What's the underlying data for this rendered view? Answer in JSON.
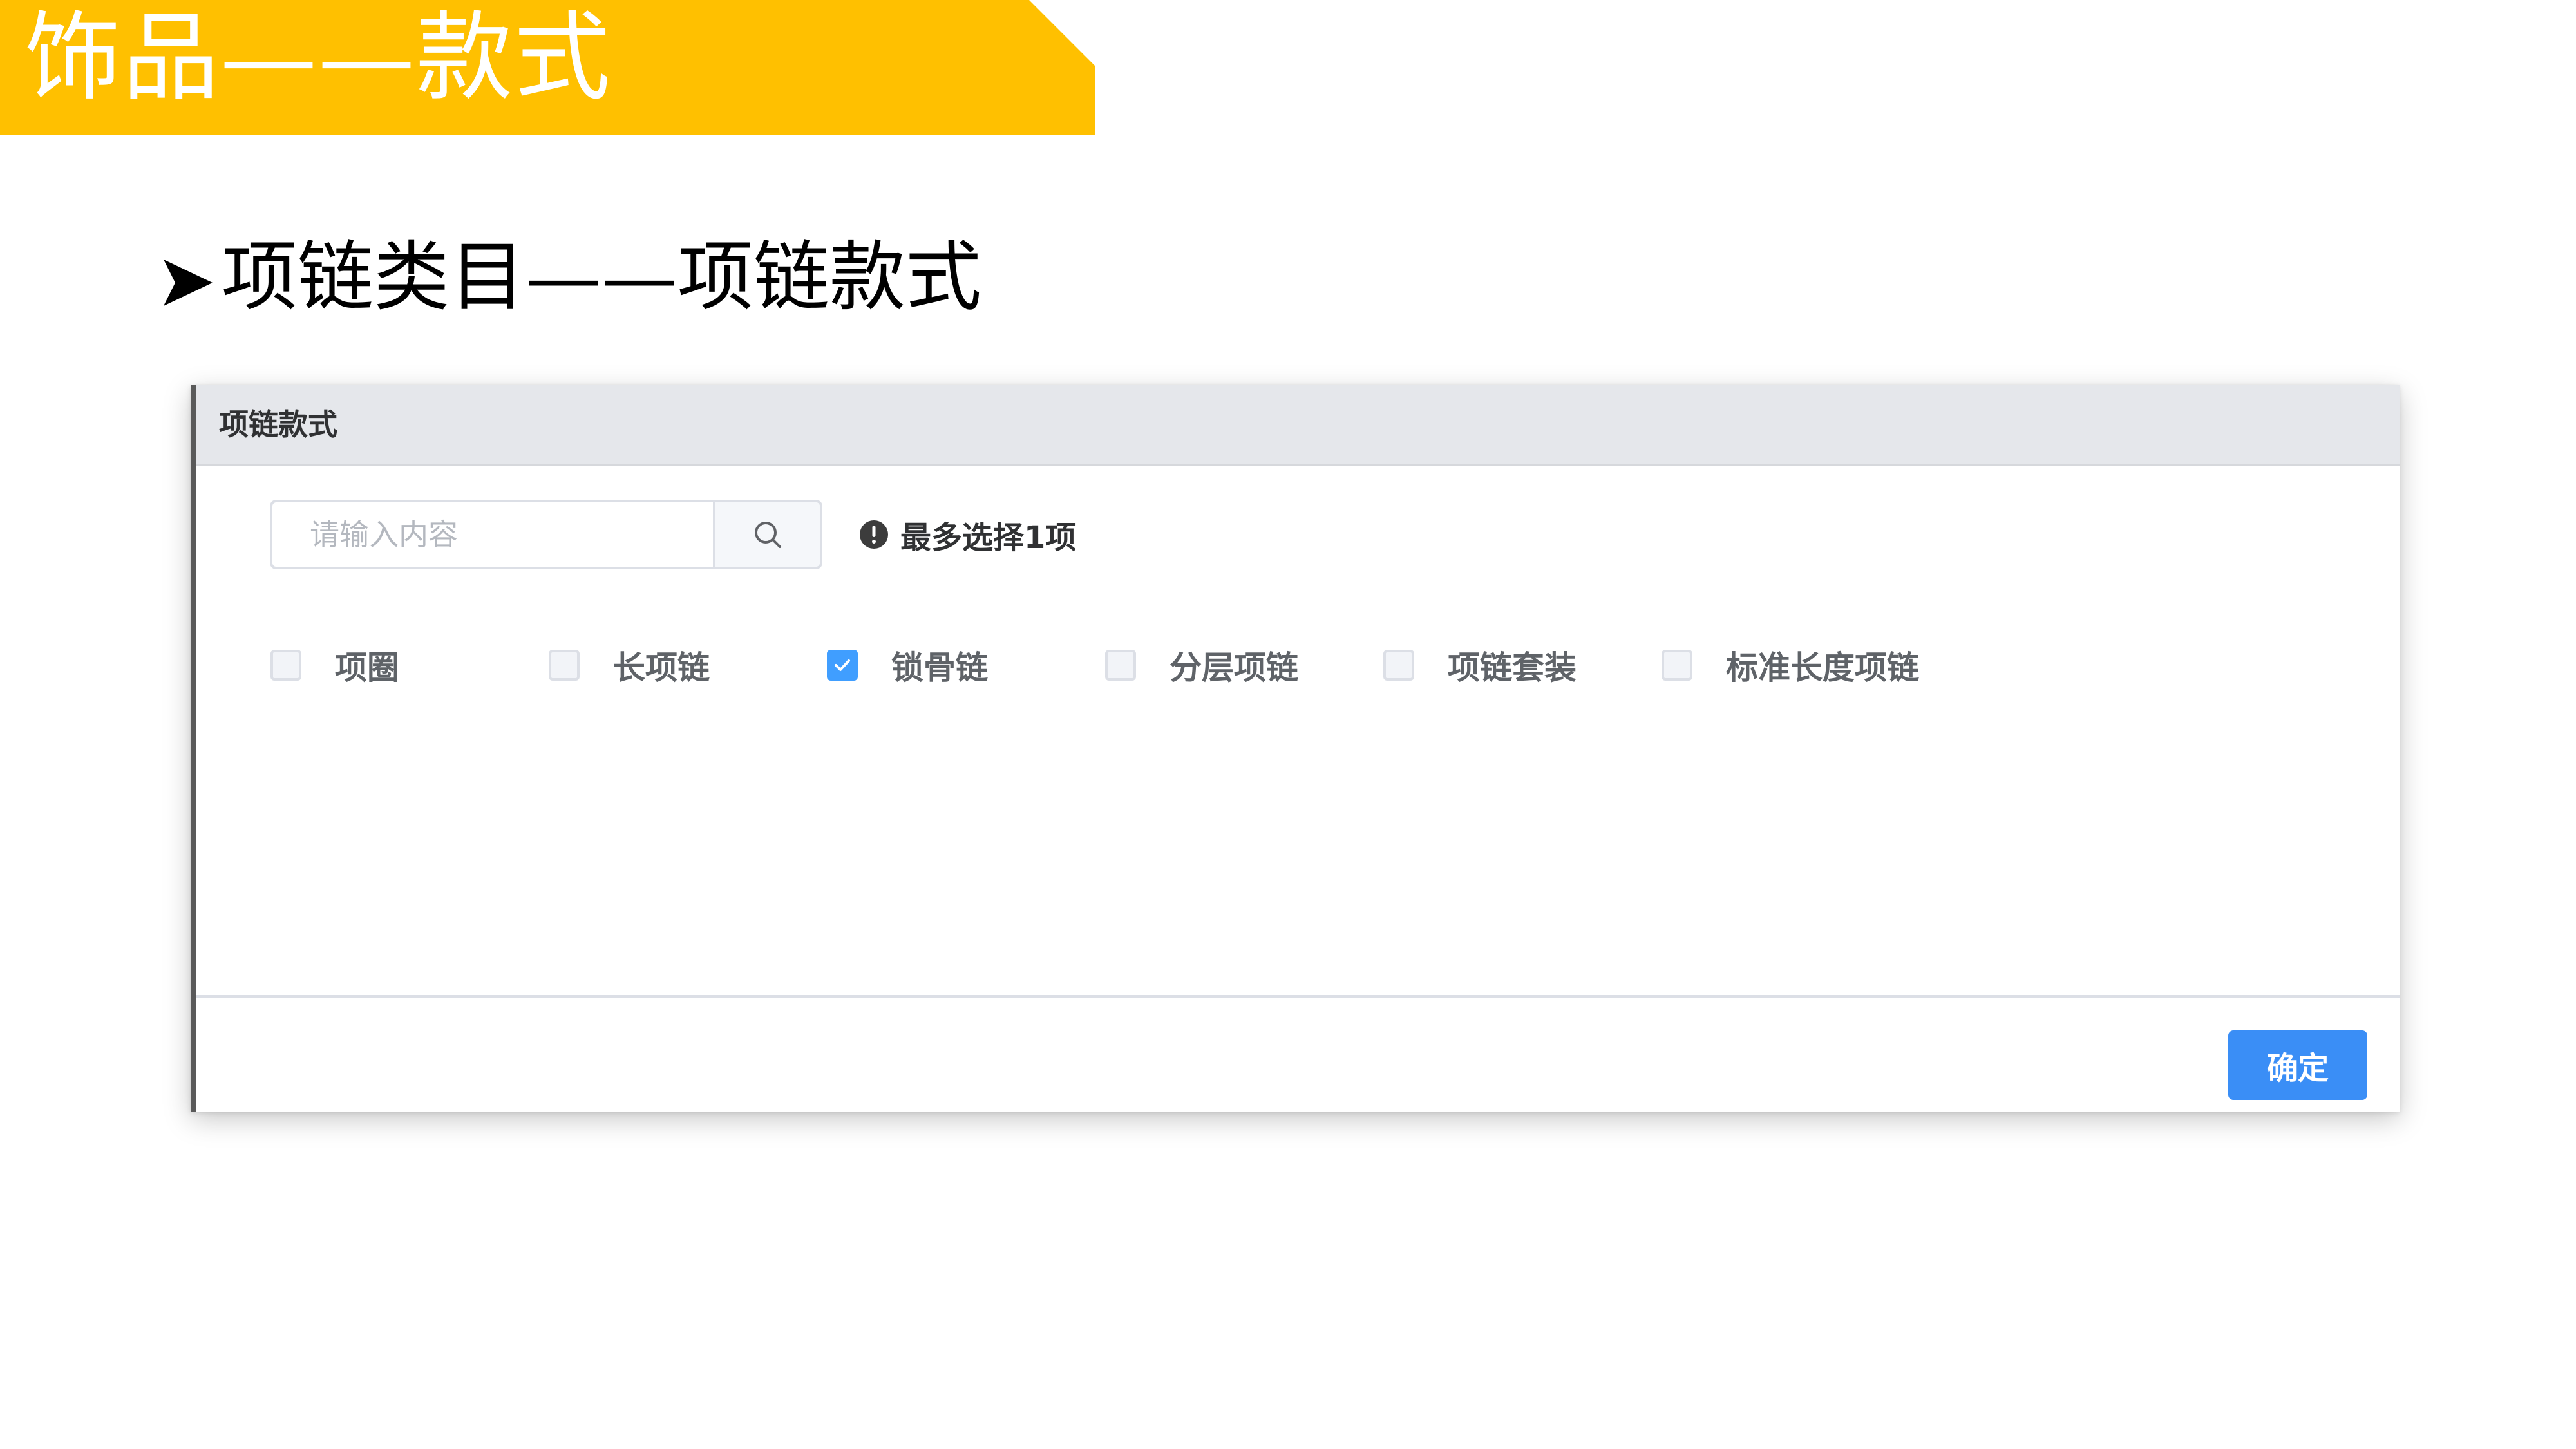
{
  "slide": {
    "title": "饰品——款式",
    "heading": "项链类目——项链款式"
  },
  "dialog": {
    "title": "项链款式",
    "search": {
      "value": "",
      "placeholder": "请输入内容",
      "icon": "search-icon"
    },
    "hint": {
      "icon": "exclamation-circle-icon",
      "text": "最多选择1项"
    },
    "options": [
      {
        "label": "项圈",
        "checked": false
      },
      {
        "label": "长项链",
        "checked": false
      },
      {
        "label": "锁骨链",
        "checked": true
      },
      {
        "label": "分层项链",
        "checked": false
      },
      {
        "label": "项链套装",
        "checked": false
      },
      {
        "label": "标准长度项链",
        "checked": false
      }
    ],
    "confirm_label": "确定"
  },
  "colors": {
    "banner": "#ffc000",
    "primary": "#409eff",
    "header_bg": "#e5e7eb"
  }
}
